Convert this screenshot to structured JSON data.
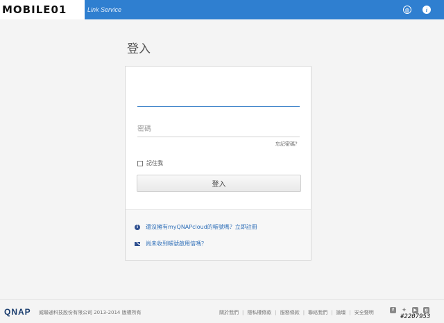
{
  "header": {
    "logo_text": "MOBILE01",
    "service_title": "Link Service",
    "globe_icon": "globe-icon",
    "info_icon": "info-icon"
  },
  "page": {
    "title": "登入"
  },
  "login": {
    "account_placeholder": "",
    "password_placeholder": "密碼",
    "forgot_label": "忘記密碼？",
    "remember_label": "記住我",
    "submit_label": "登入"
  },
  "help": {
    "register_text": "還沒擁有myQNAPcloud的帳號嗎？立即註冊",
    "activation_text": "尚未收到帳號啟用信嗎？"
  },
  "footer": {
    "logo": "QNAP",
    "copyright": "威聯通科技股份有限公司 2013-2014 版權所有",
    "links": [
      "關於我們",
      "隱私權條款",
      "服務條款",
      "聯絡我們",
      "論壇",
      "安全聲明"
    ],
    "social_icons": [
      "facebook-icon",
      "twitter-icon",
      "youtube-icon",
      "googleplus-icon"
    ]
  },
  "watermark": {
    "id_text": "#2207953"
  },
  "colors": {
    "brand_blue": "#2f7fd0",
    "link_blue": "#2f6fb8"
  }
}
